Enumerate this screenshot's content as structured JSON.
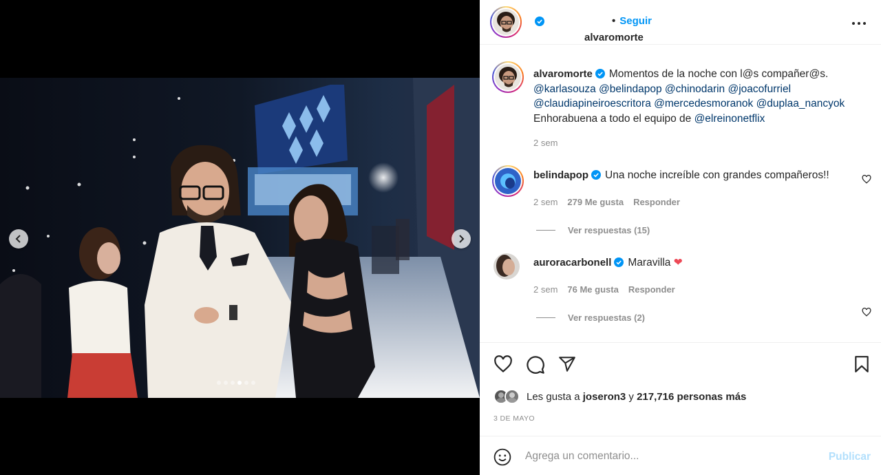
{
  "post": {
    "author": "alvaromorte",
    "follow_dot": "•",
    "follow_label": "Seguir",
    "more_icon": "more-horizontal-icon",
    "carousel": {
      "slide_count": 6,
      "active_index": 3
    }
  },
  "caption": {
    "username": "alvaromorte",
    "text_line1": "Momentos de la noche con l@s compañer@s.",
    "mentions_line2": [
      "@karlasouza",
      "@belindapop",
      "@chinodarin",
      "@joacofurriel"
    ],
    "mentions_line3": [
      "@claudiapineiroescritora",
      "@mercedesmoranok",
      "@duplaa_nancyok"
    ],
    "text_line4": "Enhorabuena a todo el equipo de ",
    "mention_line4": "@elreinonetflix",
    "time": "2 sem"
  },
  "comments": [
    {
      "username": "belindapop",
      "text": "Una noche increíble con grandes compañeros!!",
      "time": "2 sem",
      "likes": "279 Me gusta",
      "reply_label": "Responder",
      "view_replies": "Ver respuestas (15)"
    },
    {
      "username": "auroracarbonell",
      "text": "Maravilla ",
      "emoji": "❤",
      "time": "2 sem",
      "likes": "76 Me gusta",
      "reply_label": "Responder",
      "view_replies": "Ver respuestas (2)"
    }
  ],
  "actions": {
    "like_icon": "heart-icon",
    "comment_icon": "comment-icon",
    "share_icon": "share-icon",
    "save_icon": "bookmark-icon"
  },
  "likes": {
    "prefix": "Les gusta a ",
    "first_user": "joseron3",
    "middle": " y ",
    "others": "217,716 personas más"
  },
  "date": "3 DE MAYO",
  "add_comment": {
    "placeholder": "Agrega un comentario...",
    "publish_label": "Publicar"
  },
  "colors": {
    "accent": "#0095f6",
    "publish_disabled": "#b2dffc",
    "mention": "#00376b",
    "heart": "#ed4956",
    "muted": "#8e8e8e"
  }
}
